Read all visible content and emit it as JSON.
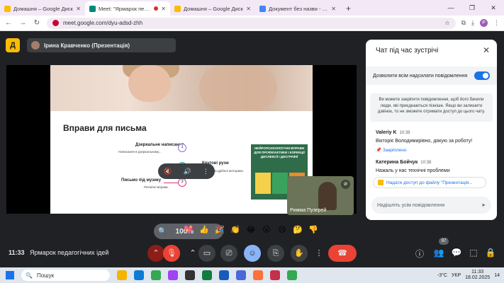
{
  "browser": {
    "tabs": [
      {
        "title": "Домашня – Google Диск",
        "color": "#fbbc04",
        "active": false
      },
      {
        "title": "Meet: \"Ярмарок педагогі",
        "color": "#00897b",
        "active": true
      },
      {
        "title": "Домашня – Google Диск",
        "color": "#fbbc04",
        "active": false
      },
      {
        "title": "Документ без назви - Google",
        "color": "#4285f4",
        "active": false
      }
    ],
    "new_tab": "+",
    "url": "meet.google.com/dyu-adsd-zhh",
    "profile_initial": "P"
  },
  "meet": {
    "logo_letter": "Д",
    "presenter": "Ірина Кравченко (Презентація)",
    "slide": {
      "title": "Вправи для письма",
      "items": [
        {
          "label": "Дзеркальне написання",
          "sub": "Написання в дзеркальному...",
          "num": "1"
        },
        {
          "label": "Кругові рухи",
          "sub": "Розвиток дрібної моторики.",
          "num": "2"
        },
        {
          "label": "Письмо під музику",
          "sub": "Ритмічні вправи.",
          "num": "3"
        }
      ],
      "book_title": "НЕЙРОПСИХОЛОГІЧНІ ВПРАВИ ДЛЯ ПРОФІЛАКТИКИ І КОРЕКЦІЇ ДИСЛЕКСІЇ І ДИСГРАФІЇ"
    },
    "zoom": {
      "minus": "−",
      "percent": "100%",
      "plus": "+"
    },
    "participant_tile": {
      "name": "Римма Пузерей"
    },
    "reactions": [
      "💖",
      "👍",
      "🎉",
      "👏",
      "😂",
      "😮",
      "😢",
      "🤔",
      "👎"
    ],
    "bottom": {
      "time": "11:33",
      "meeting_name": "Ярмарок педагогічних ідей",
      "participants_count": "97"
    }
  },
  "chat": {
    "title": "Чат під час зустрічі",
    "allow_label": "Дозволити всім надсилати повідомлення",
    "info": "Ви можете закріпити повідомлення, щоб його бачили люди, які приєднаються пізніше. Якщо ви залишите дзвінок, то не зможете отримати доступ до цього чату.",
    "messages": [
      {
        "author": "Valeriy K",
        "time": "10:38",
        "text": "Вікторіє Володимирівно, дякую за роботу!",
        "pinned": "Закріплено"
      },
      {
        "author": "Катерина Бойчук",
        "time": "10:38",
        "text": "Нажаль у нас технічні проблеми"
      }
    ],
    "share_chip": "Надати доступ до файлу \"Презентація...",
    "placeholder": "Надішліть усім повідомлення"
  },
  "taskbar": {
    "search": "Пошук",
    "weather": "-3°C",
    "lang": "УКР",
    "time": "11:33",
    "date": "18.02.2025",
    "notif": "14"
  }
}
